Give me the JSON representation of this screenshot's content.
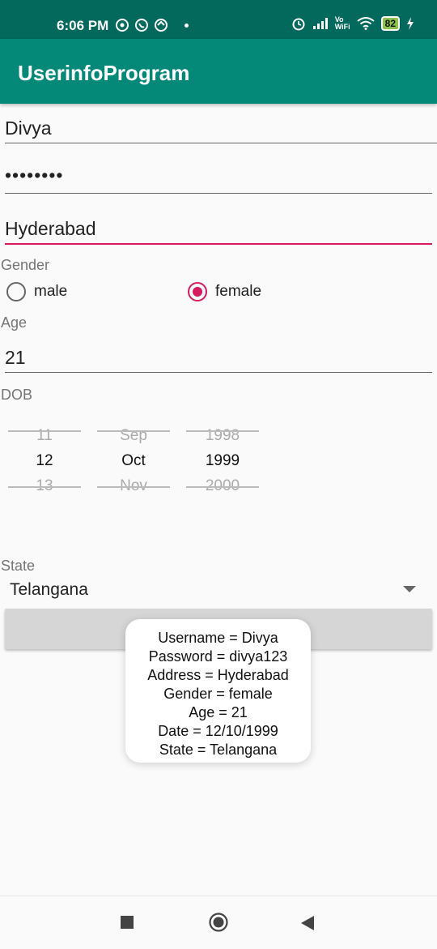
{
  "status_bar": {
    "time": "6:06 PM",
    "battery": "82",
    "network_label_top": "Vo",
    "network_label_bottom": "WiFi"
  },
  "app_bar": {
    "title": "UserinfoProgram"
  },
  "form": {
    "username": "Divya",
    "password_masked": "••••••••",
    "address": "Hyderabad",
    "gender_label": "Gender",
    "gender_options": [
      {
        "label": "male",
        "selected": false
      },
      {
        "label": "female",
        "selected": true
      }
    ],
    "age_label": "Age",
    "age": "21",
    "dob_label": "DOB",
    "dob_picker": {
      "day": {
        "prev": "11",
        "current": "12",
        "next": "13"
      },
      "month": {
        "prev": "Sep",
        "current": "Oct",
        "next": "Nov"
      },
      "year": {
        "prev": "1998",
        "current": "1999",
        "next": "2000"
      }
    },
    "state_label": "State",
    "state": "Telangana"
  },
  "toast": {
    "lines": [
      "Username = Divya",
      "Password = divya123",
      "Address = Hyderabad",
      "Gender = female",
      "Age = 21",
      "Date = 12/10/1999",
      "State = Telangana"
    ]
  },
  "colors": {
    "status_bar": "#02695c",
    "app_bar": "#048878",
    "accent": "#d81b60"
  },
  "nav_icons": [
    "square-recents-icon",
    "circle-home-icon",
    "triangle-back-icon"
  ]
}
